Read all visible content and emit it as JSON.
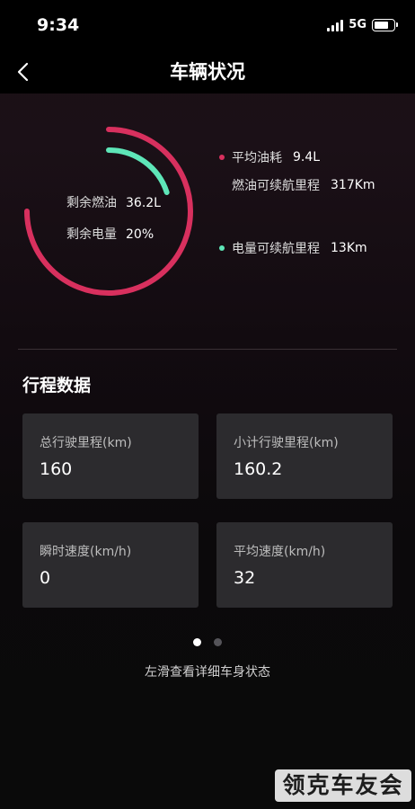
{
  "status_bar": {
    "time": "9:34",
    "network": "5G"
  },
  "nav": {
    "title": "车辆状况"
  },
  "gauge": {
    "fuel_label": "剩余燃油",
    "fuel_value": "36.2L",
    "battery_label": "剩余电量",
    "battery_value": "20%",
    "fuel_arc_fraction": 0.75,
    "battery_arc_fraction": 0.2,
    "fuel_color": "#d8305e",
    "battery_color": "#5ee6b8"
  },
  "legend": {
    "avg_fuel_label": "平均油耗",
    "avg_fuel_value": "9.4L",
    "fuel_range_label": "燃油可续航里程",
    "fuel_range_value": "317Km",
    "elec_range_label": "电量可续航里程",
    "elec_range_value": "13Km"
  },
  "trip": {
    "title": "行程数据",
    "cards": [
      {
        "label": "总行驶里程(km)",
        "value": "160"
      },
      {
        "label": "小计行驶里程(km)",
        "value": "160.2"
      },
      {
        "label": "瞬时速度(km/h)",
        "value": "0"
      },
      {
        "label": "平均速度(km/h)",
        "value": "32"
      }
    ]
  },
  "pager": {
    "hint": "左滑查看详细车身状态",
    "active_index": 0,
    "count": 2
  },
  "watermark": {
    "text": "领克车友会"
  },
  "colors": {
    "accent_red": "#d8305e",
    "accent_green": "#5ee6b8",
    "card_bg": "#2c2b2e"
  }
}
